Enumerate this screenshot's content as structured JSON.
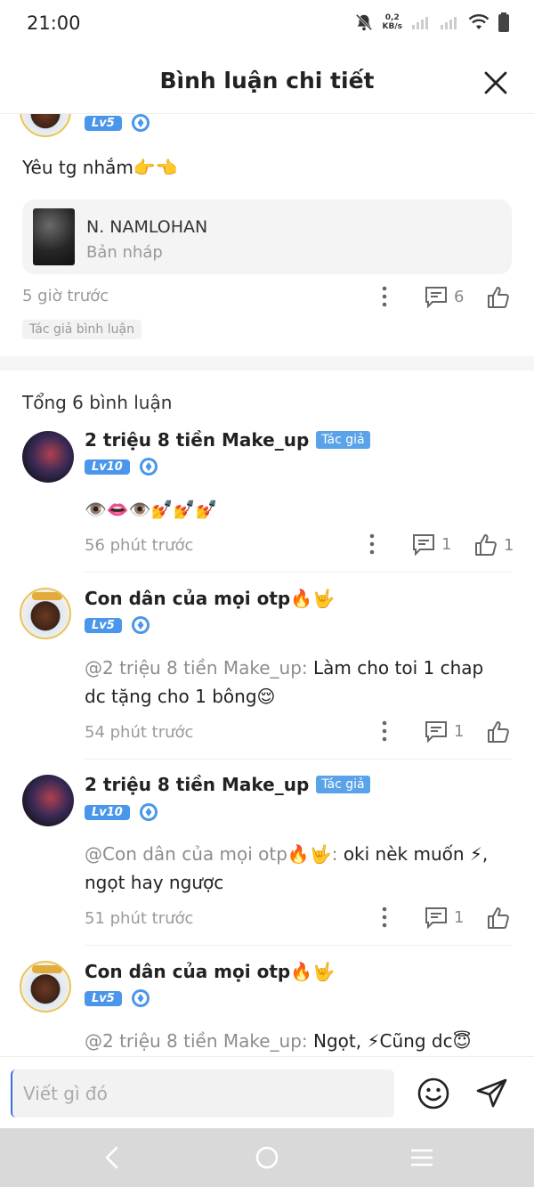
{
  "status": {
    "time": "21:00",
    "net_speed_value": "0,2",
    "net_speed_unit": "KB/s"
  },
  "header": {
    "title": "Bình luận chi tiết"
  },
  "main_comment": {
    "level": "Lv5",
    "text": "Yêu tg nhắm👉👈",
    "draft": {
      "title": "N. NAMLOHAN",
      "subtitle": "Bản nháp"
    },
    "time": "5 giờ trước",
    "reply_count": "6",
    "tag": "Tác giả bình luận"
  },
  "total_label": "Tổng 6 bình luận",
  "replies": [
    {
      "username": "2 triệu 8 tiền Make_up",
      "author_tag": "Tác giả",
      "level": "Lv10",
      "mention": "",
      "text": "👁️👄👁️💅💅💅",
      "time": "56 phút trước",
      "reply_count": "1",
      "like_count": "1"
    },
    {
      "username": "Con dân của mọi otp🔥🤟",
      "author_tag": "",
      "level": "Lv5",
      "mention": "@2 triệu 8 tiền Make_up: ",
      "text": "Làm cho toi 1 chap dc tặng cho 1 bông😌",
      "time": "54 phút trước",
      "reply_count": "1",
      "like_count": ""
    },
    {
      "username": "2 triệu 8 tiền Make_up",
      "author_tag": "Tác giả",
      "level": "Lv10",
      "mention": "@Con dân của mọi otp🔥🤟: ",
      "text": "oki nèk muốn ⚡, ngọt hay ngược",
      "time": "51 phút trước",
      "reply_count": "1",
      "like_count": ""
    },
    {
      "username": "Con dân của mọi otp🔥🤟",
      "author_tag": "",
      "level": "Lv5",
      "mention": "@2 triệu 8 tiền Make_up: ",
      "text": "Ngọt, ⚡Cũng dc😇",
      "time": "",
      "reply_count": "",
      "like_count": ""
    }
  ],
  "input": {
    "placeholder": "Viết gì đó"
  },
  "icons": {
    "close": "close-icon",
    "more": "more-vertical-icon",
    "comment": "comment-icon",
    "like": "thumbs-up-icon",
    "emoji": "smiley-icon",
    "send": "send-icon",
    "back": "back-icon",
    "home": "home-circle-icon",
    "menu": "menu-icon"
  },
  "colors": {
    "accent": "#4a96ea",
    "author_tag": "#5aa3e8"
  }
}
